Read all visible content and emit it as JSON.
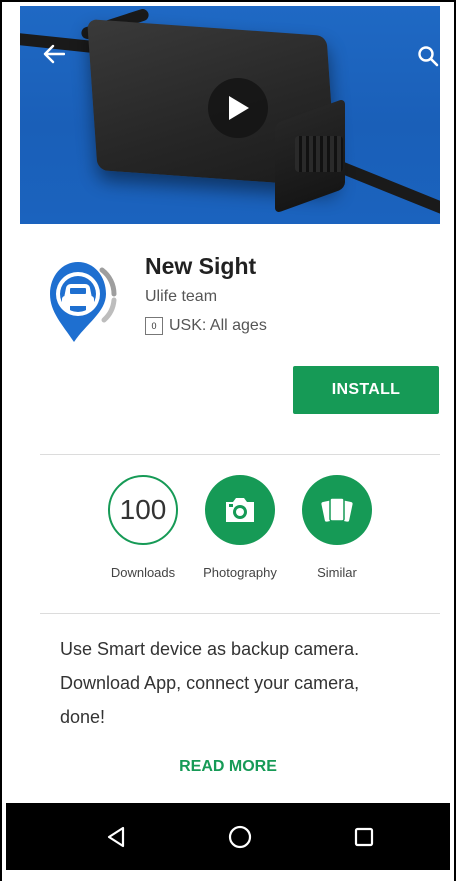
{
  "hero": {
    "back_icon": "arrow-left-icon",
    "search_icon": "search-icon",
    "play_icon": "play-icon",
    "background": "#1f69c4"
  },
  "app": {
    "title": "New Sight",
    "developer": "Ulife team",
    "usk_badge": "0",
    "rating": "USK: All ages",
    "install_label": "INSTALL"
  },
  "stats": [
    {
      "value": "100",
      "label": "Downloads"
    },
    {
      "icon": "camera-icon",
      "label": "Photography"
    },
    {
      "icon": "cards-icon",
      "label": "Similar"
    }
  ],
  "description": {
    "line1": "Use Smart device as backup camera.",
    "line2": "Download App, connect your camera,",
    "line3": "done!",
    "read_more": "READ MORE"
  },
  "navbar": {
    "back": "nav-back-icon",
    "home": "nav-home-icon",
    "recents": "nav-recents-icon"
  },
  "colors": {
    "accent": "#169a56",
    "hero_blue": "#1f69c4",
    "icon_blue": "#1e6fd0"
  }
}
